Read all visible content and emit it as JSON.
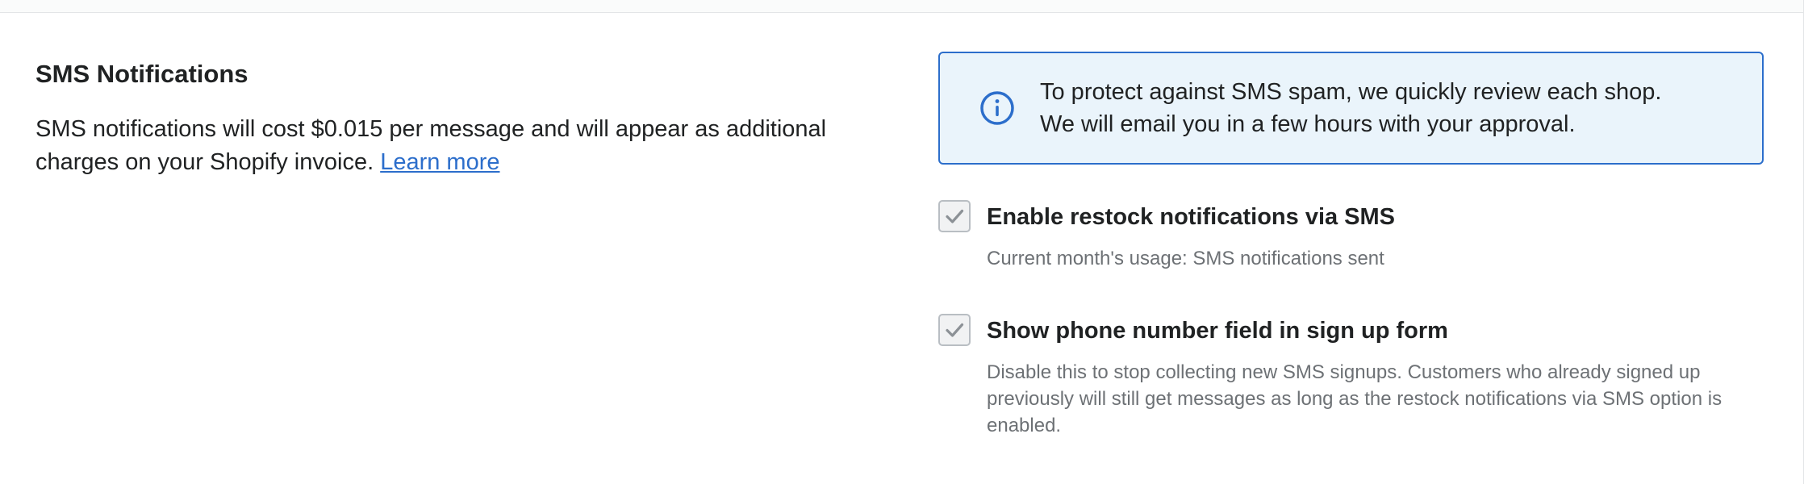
{
  "section": {
    "title": "SMS Notifications",
    "description": "SMS notifications will cost $0.015 per message and will appear as additional charges on your Shopify invoice. ",
    "learn_more_label": "Learn more"
  },
  "banner": {
    "icon": "info-icon",
    "line1": "To protect against SMS spam, we quickly review each shop.",
    "line2": "We will email you in a few hours with your approval.",
    "accent_color": "#2c6ecb",
    "background_color": "#eaf4fb"
  },
  "options": [
    {
      "label": "Enable restock notifications via SMS",
      "help": "Current month's usage: SMS notifications sent",
      "checked": true
    },
    {
      "label": "Show phone number field in sign up form",
      "help": "Disable this to stop collecting new SMS signups. Customers who already signed up previously will still get messages as long as the restock notifications via SMS option is enabled.",
      "checked": true
    }
  ]
}
